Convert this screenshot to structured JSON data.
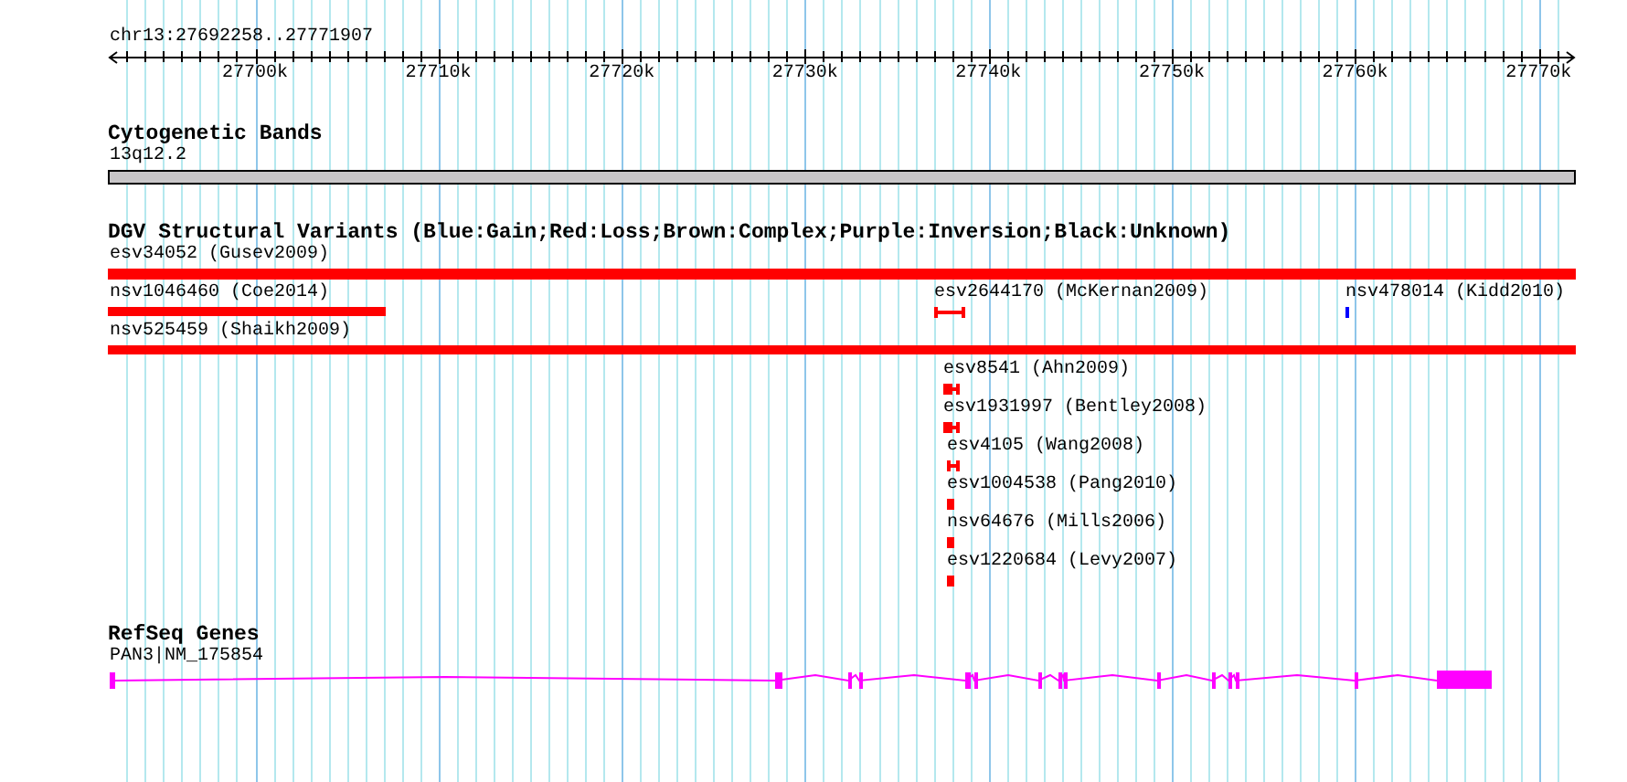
{
  "ruler": {
    "location": "chr13:27692258..27771907",
    "ticks": [
      "27700k",
      "27710k",
      "27720k",
      "27730k",
      "27740k",
      "27750k",
      "27760k",
      "27770k"
    ]
  },
  "tracks": [
    {
      "kind": "cytoband",
      "title": "Cytogenetic Bands",
      "bands": [
        {
          "label": "13q12.2"
        }
      ]
    },
    {
      "kind": "variants",
      "title": "DGV Structural Variants (Blue:Gain;Red:Loss;Brown:Complex;Purple:Inversion;Black:Unknown)",
      "features": [
        {
          "label": "esv34052 (Gusev2009)",
          "color": "#ff0000"
        },
        {
          "label": "nsv1046460 (Coe2014)",
          "color": "#ff0000"
        },
        {
          "label": "esv2644170 (McKernan2009)",
          "color": "#ff0000"
        },
        {
          "label": "nsv478014 (Kidd2010)",
          "color": "#0000ff"
        },
        {
          "label": "nsv525459 (Shaikh2009)",
          "color": "#ff0000"
        },
        {
          "label": "esv8541 (Ahn2009)",
          "color": "#ff0000"
        },
        {
          "label": "esv1931997 (Bentley2008)",
          "color": "#ff0000"
        },
        {
          "label": "esv4105 (Wang2008)",
          "color": "#ff0000"
        },
        {
          "label": "esv1004538 (Pang2010)",
          "color": "#ff0000"
        },
        {
          "label": "nsv64676 (Mills2006)",
          "color": "#ff0000"
        },
        {
          "label": "esv1220684 (Levy2007)",
          "color": "#ff0000"
        }
      ]
    },
    {
      "kind": "genes",
      "title": "RefSeq Genes",
      "genes": [
        {
          "label": "PAN3|NM_175854"
        }
      ]
    }
  ]
}
